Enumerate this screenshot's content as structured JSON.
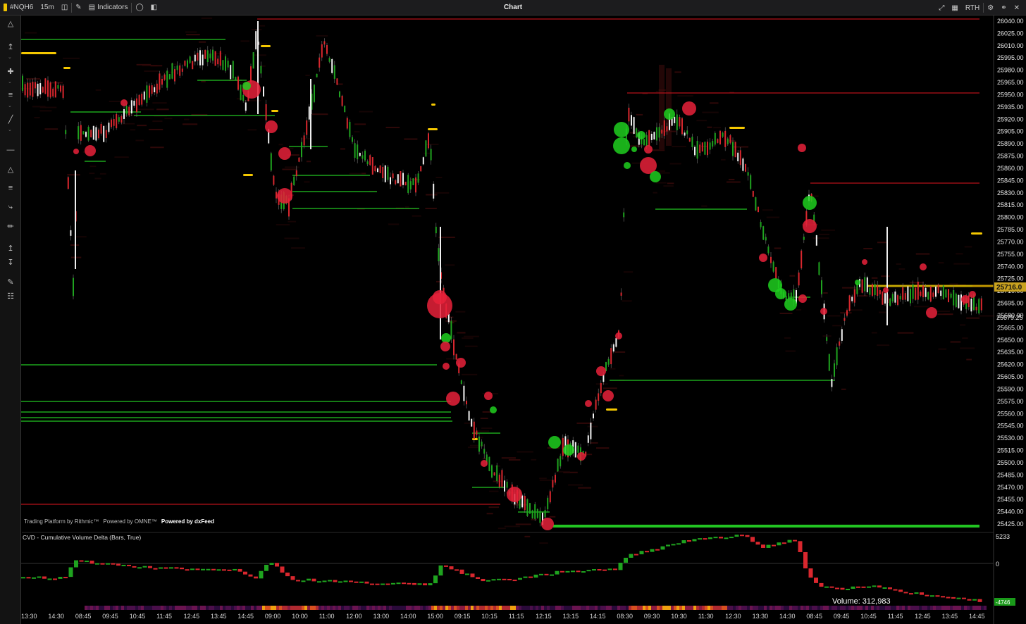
{
  "toolbar": {
    "symbol": "#NQH6",
    "interval": "15m",
    "indicators_label": "Indicators",
    "title": "Chart",
    "session": "RTH"
  },
  "credits": {
    "rithmic": "Trading Platform by Rithmic™",
    "omne": "Powered by OMNE™",
    "dxfeed": "Powered by dxFeed"
  },
  "cvd": {
    "title": "CVD - Cumulative Volume Delta (Bars, True)",
    "axis_top": "5233",
    "axis_zero": "0",
    "axis_bottom_badge": "-4746"
  },
  "volume_label": "Volume: 312,983",
  "price_badges": {
    "current": "25716.0",
    "last": "25679.25"
  },
  "price_axis": [
    "26040.00",
    "26025.00",
    "26010.00",
    "25995.00",
    "25980.00",
    "25965.00",
    "25950.00",
    "25935.00",
    "25920.00",
    "25905.00",
    "25890.00",
    "25875.00",
    "25860.00",
    "25845.00",
    "25830.00",
    "25815.00",
    "25800.00",
    "25785.00",
    "25770.00",
    "25755.00",
    "25740.00",
    "25725.00",
    "25710.00",
    "25695.00",
    "25680.00",
    "25665.00",
    "25650.00",
    "25635.00",
    "25620.00",
    "25605.00",
    "25590.00",
    "25575.00",
    "25560.00",
    "25545.00",
    "25530.00",
    "25515.00",
    "25500.00",
    "25485.00",
    "25470.00",
    "25455.00",
    "25440.00",
    "25425.00"
  ],
  "time_axis": [
    "13:30",
    "14:30",
    "08:45",
    "09:45",
    "10:45",
    "11:45",
    "12:45",
    "13:45",
    "14:45",
    "09:00",
    "10:00",
    "11:00",
    "12:00",
    "13:00",
    "14:00",
    "15:00",
    "09:15",
    "10:15",
    "11:15",
    "12:15",
    "13:15",
    "14:15",
    "08:30",
    "09:30",
    "10:30",
    "11:30",
    "12:30",
    "13:30",
    "14:30",
    "08:45",
    "09:45",
    "10:45",
    "11:45",
    "12:45",
    "13:45",
    "14:45"
  ],
  "colors": {
    "up": "#1fa31f",
    "down": "#d9272e",
    "support": "#22c522",
    "resistance": "#b5121b",
    "highlight": "#e6b400",
    "background": "#000000"
  }
}
